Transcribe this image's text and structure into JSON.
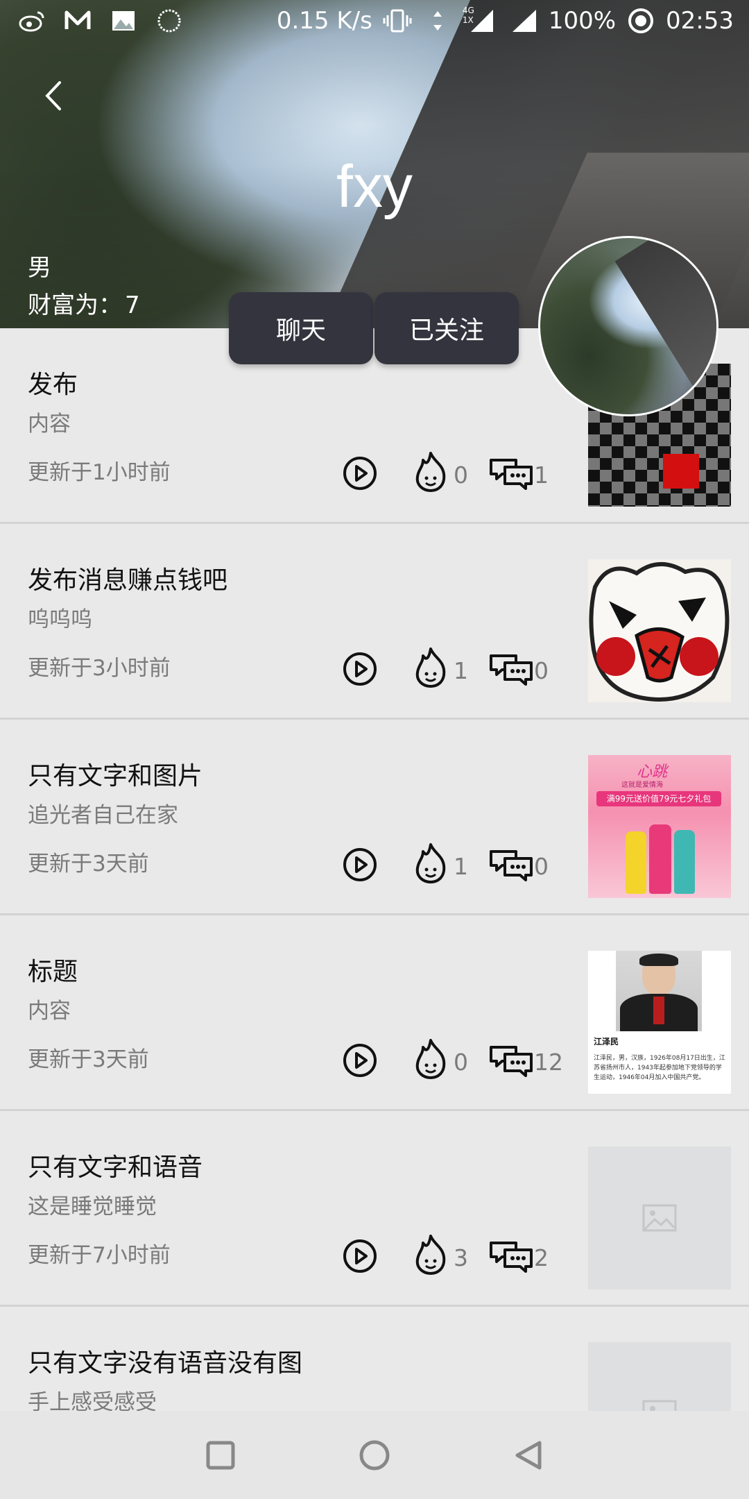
{
  "status_bar": {
    "speed": "0.15 K/s",
    "network_badge": "4G 1X",
    "battery": "100%",
    "time": "02:53",
    "icons": [
      "weibo-icon",
      "m-icon",
      "image-icon",
      "circle-icon",
      "vibrate-icon",
      "data-arrows-icon",
      "signal-icon",
      "signal-icon",
      "alarm-icon"
    ]
  },
  "profile": {
    "username": "fxy",
    "gender": "男",
    "wealth_label": "财富为：",
    "wealth_value": "7",
    "chat_button": "聊天",
    "follow_button": "已关注"
  },
  "posts": [
    {
      "title": "发布",
      "content": "内容",
      "time": "更新于1小时前",
      "likes": "0",
      "comments": "1",
      "thumb": "checker"
    },
    {
      "title": "发布消息赚点钱吧",
      "content": "呜呜呜",
      "time": "更新于3小时前",
      "likes": "1",
      "comments": "0",
      "thumb": "bear"
    },
    {
      "title": "只有文字和图片",
      "content": "追光者自己在家",
      "time": "更新于3天前",
      "likes": "1",
      "comments": "0",
      "thumb": "ad",
      "thumb_text": {
        "line1": "心跳",
        "line2": "这就是爱情海",
        "banner": "满99元送价值79元七夕礼包"
      }
    },
    {
      "title": "标题",
      "content": "内容",
      "time": "更新于3天前",
      "likes": "0",
      "comments": "12",
      "thumb": "news",
      "thumb_text": {
        "name": "江泽民",
        "body": "江泽民，男，汉族，1926年08月17日出生，江苏省扬州市人，1943年起参加地下党领导的学生运动，1946年04月加入中国共产党。"
      }
    },
    {
      "title": "只有文字和语音",
      "content": "这是睡觉睡觉",
      "time": "更新于7小时前",
      "likes": "3",
      "comments": "2",
      "thumb": "placeholder"
    },
    {
      "title": "只有文字没有语音没有图",
      "content": "手上感受感受",
      "time": "",
      "likes": "",
      "comments": "",
      "thumb": "placeholder"
    }
  ],
  "colors": {
    "button_bg": "#34343f",
    "background": "#e9e9e9",
    "accent_red": "#d40f0f"
  }
}
